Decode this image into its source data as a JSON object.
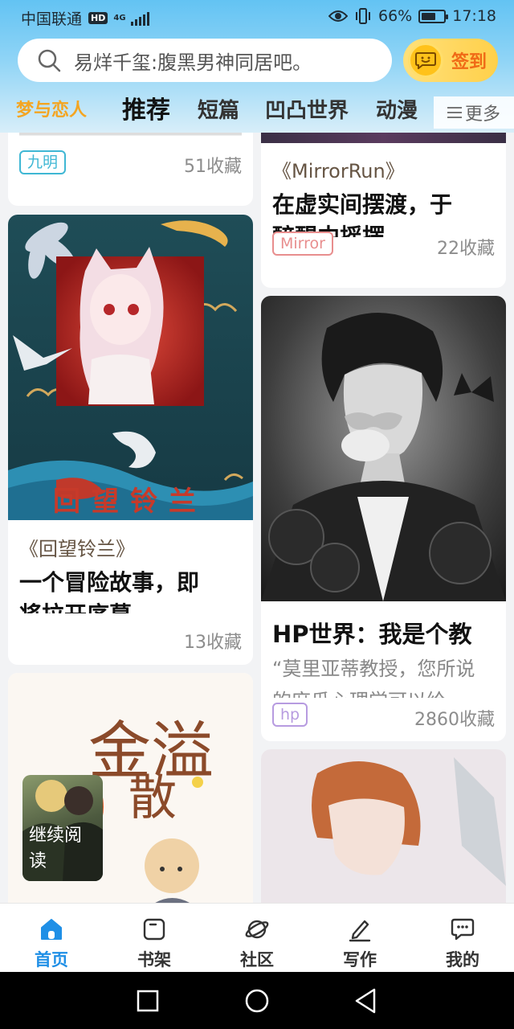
{
  "status_bar": {
    "carrier": "中国联通",
    "hd": "HD",
    "network": "4G",
    "battery": "66%",
    "battery_level": 0.66,
    "time": "17:18"
  },
  "search": {
    "placeholder": "易烊千玺:腹黑男神同居吧。"
  },
  "signin": {
    "label": "签到"
  },
  "tabs": [
    {
      "label": "梦与恋人"
    },
    {
      "label": "推荐"
    },
    {
      "label": "短篇"
    },
    {
      "label": "凹凸世界"
    },
    {
      "label": "动漫"
    }
  ],
  "more": {
    "label": "更多"
  },
  "cards": {
    "top_left": {
      "tag": "九明",
      "count": "51收藏"
    },
    "mirror": {
      "book": "《MirrorRun》",
      "title": "在虚实间摆渡，于",
      "subtitle": "醉醒中摇摆",
      "tag": "Mirror",
      "count": "22收藏"
    },
    "lilan": {
      "book": "《回望铃兰》",
      "title": "一个冒险故事，即",
      "subtitle": "将拉开序幕",
      "count": "13收藏",
      "cover_text": "回望铃兰"
    },
    "hp": {
      "title": "HP世界：我是个教",
      "desc": "“莫里亚蒂教授，您所说",
      "desc2": "的麻瓜心理学可以给",
      "tag": "hp",
      "count": "2860收藏"
    },
    "jinyi": {
      "cover_title": "金溢",
      "cover_sub": "散"
    }
  },
  "continue": {
    "label": "继续阅读"
  },
  "bottom_nav": [
    {
      "label": "首页",
      "icon": "home-icon"
    },
    {
      "label": "书架",
      "icon": "bookshelf-icon"
    },
    {
      "label": "社区",
      "icon": "planet-icon"
    },
    {
      "label": "写作",
      "icon": "pen-icon"
    },
    {
      "label": "我的",
      "icon": "chat-icon"
    }
  ],
  "colors": {
    "accent": "#1f8fe6",
    "tag_blue": "#3fb7d4",
    "tag_red": "#e88e8e",
    "tag_purple": "#b79be0",
    "signin": "#f06a16",
    "tab_highlight": "#f4a521"
  }
}
